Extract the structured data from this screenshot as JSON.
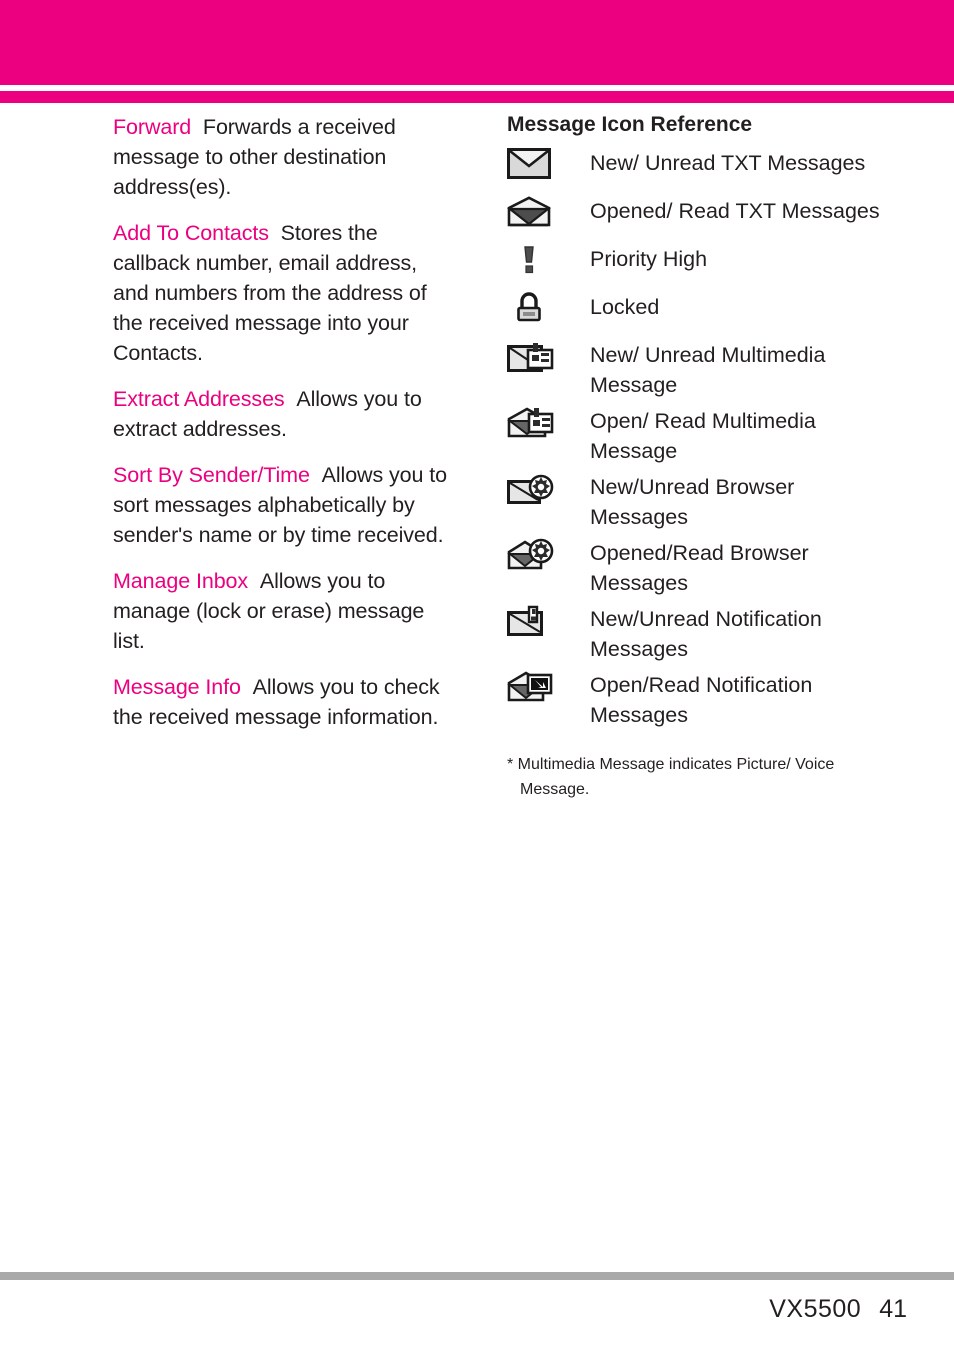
{
  "theme": {
    "accent": "#ec0080",
    "text": "#231f20",
    "rule": "#a9a9a9"
  },
  "left_column": {
    "entries": [
      {
        "term": "Forward",
        "description": "Forwards a received message to other destination address(es)."
      },
      {
        "term": "Add To Contacts",
        "description": "Stores the callback number, email address, and numbers from the address of the received message into your Contacts."
      },
      {
        "term": "Extract Addresses",
        "description": "Allows you to extract addresses."
      },
      {
        "term": "Sort By Sender/Time",
        "description": "Allows you to sort messages alphabetically by sender's name or by time received."
      },
      {
        "term": "Manage Inbox",
        "description": "Allows you to manage (lock or erase) message list."
      },
      {
        "term": "Message Info",
        "description": "Allows you to check the received message information."
      }
    ]
  },
  "right_column": {
    "title": "Message Icon Reference",
    "icons": [
      {
        "icon": "closed-envelope-icon",
        "label": "New/ Unread TXT Messages"
      },
      {
        "icon": "open-envelope-icon",
        "label": "Opened/ Read TXT Messages"
      },
      {
        "icon": "exclamation-mark-icon",
        "label": "Priority High"
      },
      {
        "icon": "padlock-icon",
        "label": "Locked"
      },
      {
        "icon": "closed-envelope-picture-icon",
        "label": "New/ Unread Multimedia Message"
      },
      {
        "icon": "open-envelope-picture-icon",
        "label": "Open/ Read Multimedia Message"
      },
      {
        "icon": "closed-envelope-globe-icon",
        "label": "New/Unread Browser Messages"
      },
      {
        "icon": "open-envelope-globe-icon",
        "label": "Opened/Read Browser Messages"
      },
      {
        "icon": "closed-envelope-notification-icon",
        "label": "New/Unread Notification Messages"
      },
      {
        "icon": "open-envelope-notification-icon",
        "label": "Open/Read Notification Messages"
      }
    ],
    "footnote": "* Multimedia Message indicates Picture/ Voice Message."
  },
  "footer": {
    "model": "VX5500",
    "page_number": "41"
  }
}
